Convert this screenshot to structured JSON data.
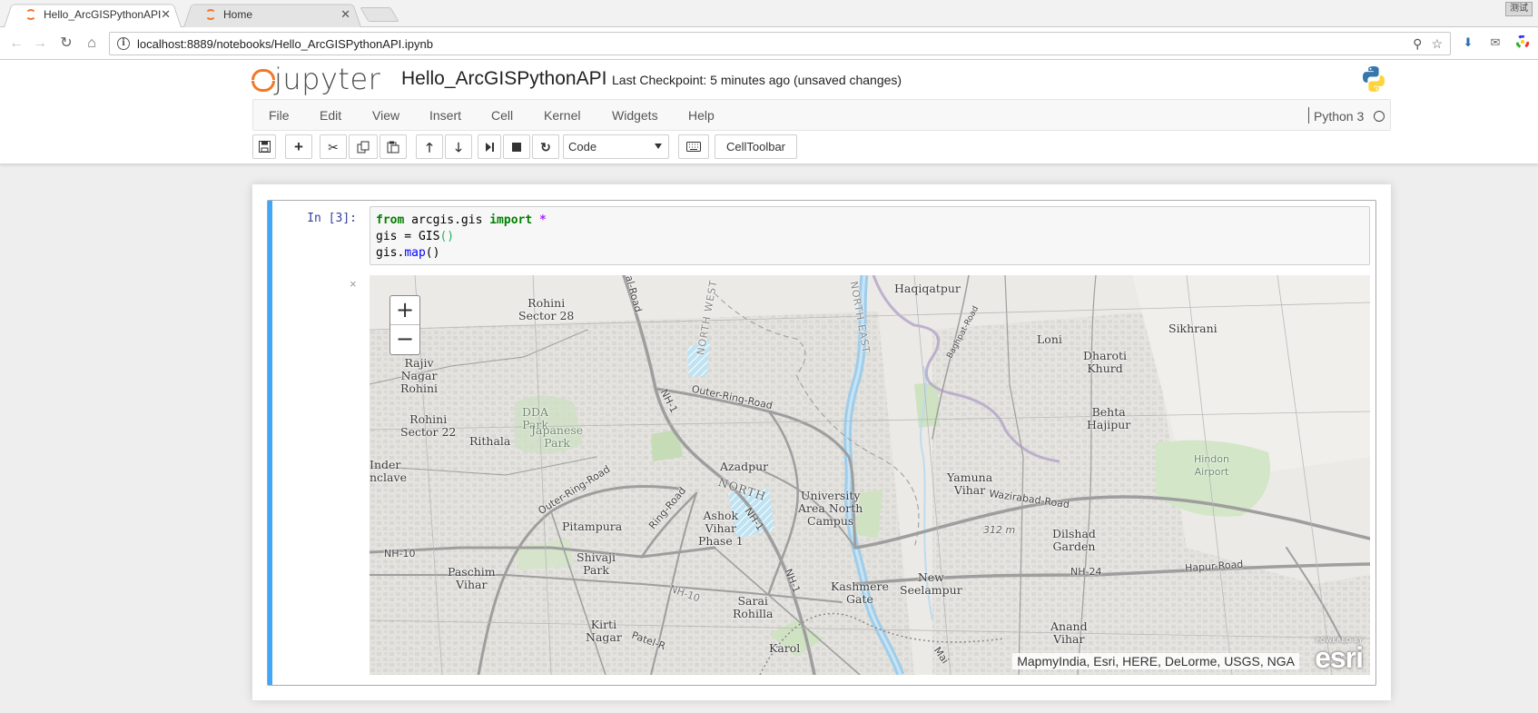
{
  "browser": {
    "tabs": [
      {
        "title": "Hello_ArcGISPythonAPI",
        "active": true
      },
      {
        "title": "Home",
        "active": false
      }
    ],
    "url": "localhost:8889/notebooks/Hello_ArcGISPythonAPI.ipynb",
    "profile_label": "测试"
  },
  "jupyter": {
    "logo_text": "jupyter",
    "notebook_name": "Hello_ArcGISPythonAPI",
    "checkpoint": "Last Checkpoint: 5 minutes ago (unsaved changes)",
    "menu": [
      "File",
      "Edit",
      "View",
      "Insert",
      "Cell",
      "Kernel",
      "Widgets",
      "Help"
    ],
    "kernel_name": "Python 3",
    "cell_type": "Code",
    "celltoolbar_label": "CellToolbar"
  },
  "cell": {
    "prompt": "In [3]:",
    "code": {
      "line1": {
        "kw1": "from",
        "mod": " arcgis.gis ",
        "kw2": "import",
        "op": " *"
      },
      "line2": {
        "a": "gis = GIS",
        "b": "()"
      },
      "line3": {
        "a": "gis.",
        "b": "map",
        "c": "()"
      }
    },
    "output_close": "×"
  },
  "map": {
    "zoom_in": "+",
    "zoom_out": "−",
    "attribution": "MapmyIndia, Esri, HERE, DeLorme, USGS, NGA",
    "powered_by": "POWERED BY",
    "esri_logo": "esri",
    "place_labels": {
      "haqiqatpur": "Haqiqatpur",
      "rohini28": "Rohini\nSector 28",
      "rajiv": "Rajiv\nNagar\nRohini",
      "rohini22": "Rohini\nSector 22",
      "rithala": "Rithala",
      "inder": "Inder\nnclave",
      "dda": "DDA\nPark",
      "japanese": "Japanese\nPark",
      "loni": "Loni",
      "sikhrani": "Sikhrani",
      "dharoti": "Dharoti\nKhurd",
      "behta": "Behta\nHajipur",
      "hindon": "Hindon\nAirport",
      "azadpur": "Azadpur",
      "north": "NORTH",
      "university": "University\nArea North\nCampus",
      "yamuna": "Yamuna\nVihar",
      "ashok": "Ashok\nVihar\nPhase 1",
      "pitampura": "Pitampura",
      "shivaji": "Shivaji\nPark",
      "paschim": "Paschim\nVihar",
      "dilshad": "Dilshad\nGarden",
      "new_seelampur": "New\nSeelampur",
      "kashmere": "Kashmere\nGate",
      "sarai": "Sarai\nRohilla",
      "kirti": "Kirti\nNagar",
      "anand": "Anand\nVihar",
      "karol": "Karol",
      "elev": "312 m"
    },
    "road_labels": {
      "nh1": "NH-1",
      "nh1b": "NH-1",
      "nh1c": "NH-1",
      "nh10": "NH-10",
      "nh10b": "NH-10",
      "nh24": "NH-24",
      "outer_ring": "Outer-Ring-Road",
      "outer_ring_w": "Outer-Ring-Road",
      "ring_road": "Ring-Road",
      "wazirabad": "Wazirabad-Road",
      "hapur": "Hapur-Road",
      "baghpat": "Baghpat-Road",
      "north_west": "NORTH WEST",
      "north_east": "NORTH EAST",
      "patel": "Patel-R",
      "mall": "al-Road",
      "main": "Mai"
    }
  }
}
